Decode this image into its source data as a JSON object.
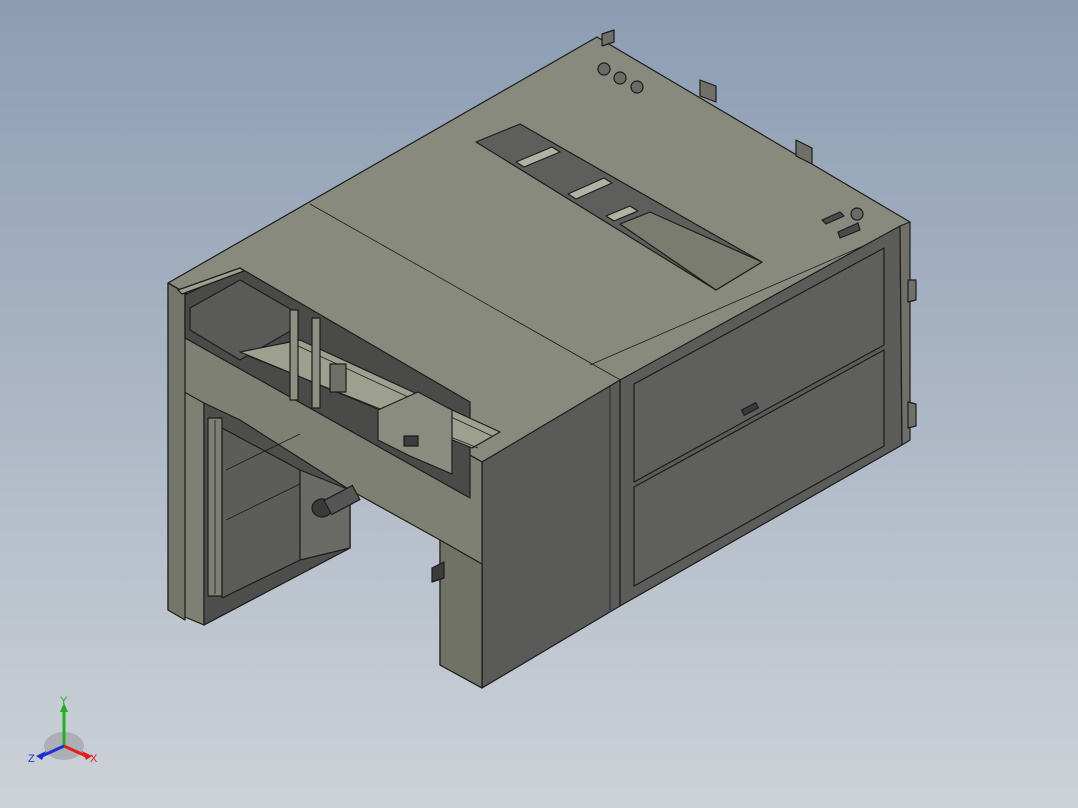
{
  "viewport": {
    "background_top": "#8c9db3",
    "background_bottom": "#cdd2d8"
  },
  "model": {
    "face_colors": {
      "top": "#878a7d",
      "left": "#7e8074",
      "front": "#5c5c5a",
      "panel": "#5f5f5e",
      "interior_dark": "#4a4a48",
      "interior_light": "#9ea08f"
    }
  },
  "triad": {
    "x_label": "X",
    "y_label": "Y",
    "z_label": "Z",
    "x_color": "#e02020",
    "y_color": "#20b020",
    "z_color": "#2030d0"
  }
}
